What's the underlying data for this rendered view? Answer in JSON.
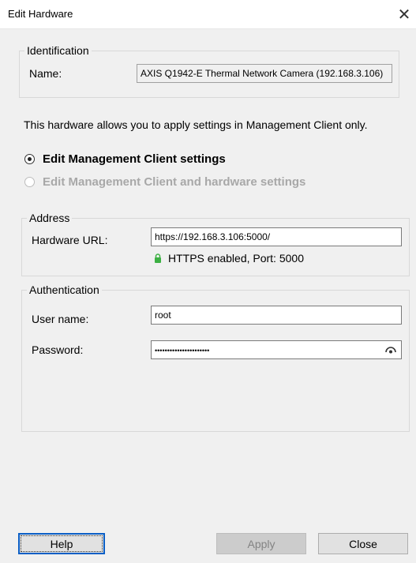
{
  "window": {
    "title": "Edit Hardware"
  },
  "identification": {
    "legend": "Identification",
    "name_label": "Name:",
    "name_value": "AXIS Q1942-E Thermal Network Camera (192.168.3.106)"
  },
  "info_text": "This hardware allows you to apply settings in Management Client only.",
  "radios": {
    "option1": "Edit Management Client settings",
    "option2": "Edit Management Client and hardware settings"
  },
  "address": {
    "legend": "Address",
    "url_label": "Hardware URL:",
    "url_value": "https://192.168.3.106:5000/",
    "https_status": "HTTPS enabled, Port: 5000"
  },
  "authentication": {
    "legend": "Authentication",
    "username_label": "User name:",
    "username_value": "root",
    "password_label": "Password:",
    "password_value": "••••••••••••••••••••••"
  },
  "buttons": {
    "help": "Help",
    "apply": "Apply",
    "close": "Close"
  },
  "colors": {
    "lock_green": "#3cb043",
    "focus_blue": "#0b5fc6"
  },
  "icons": {
    "close": "close-icon",
    "lock": "lock-icon",
    "eye": "eye-icon"
  }
}
